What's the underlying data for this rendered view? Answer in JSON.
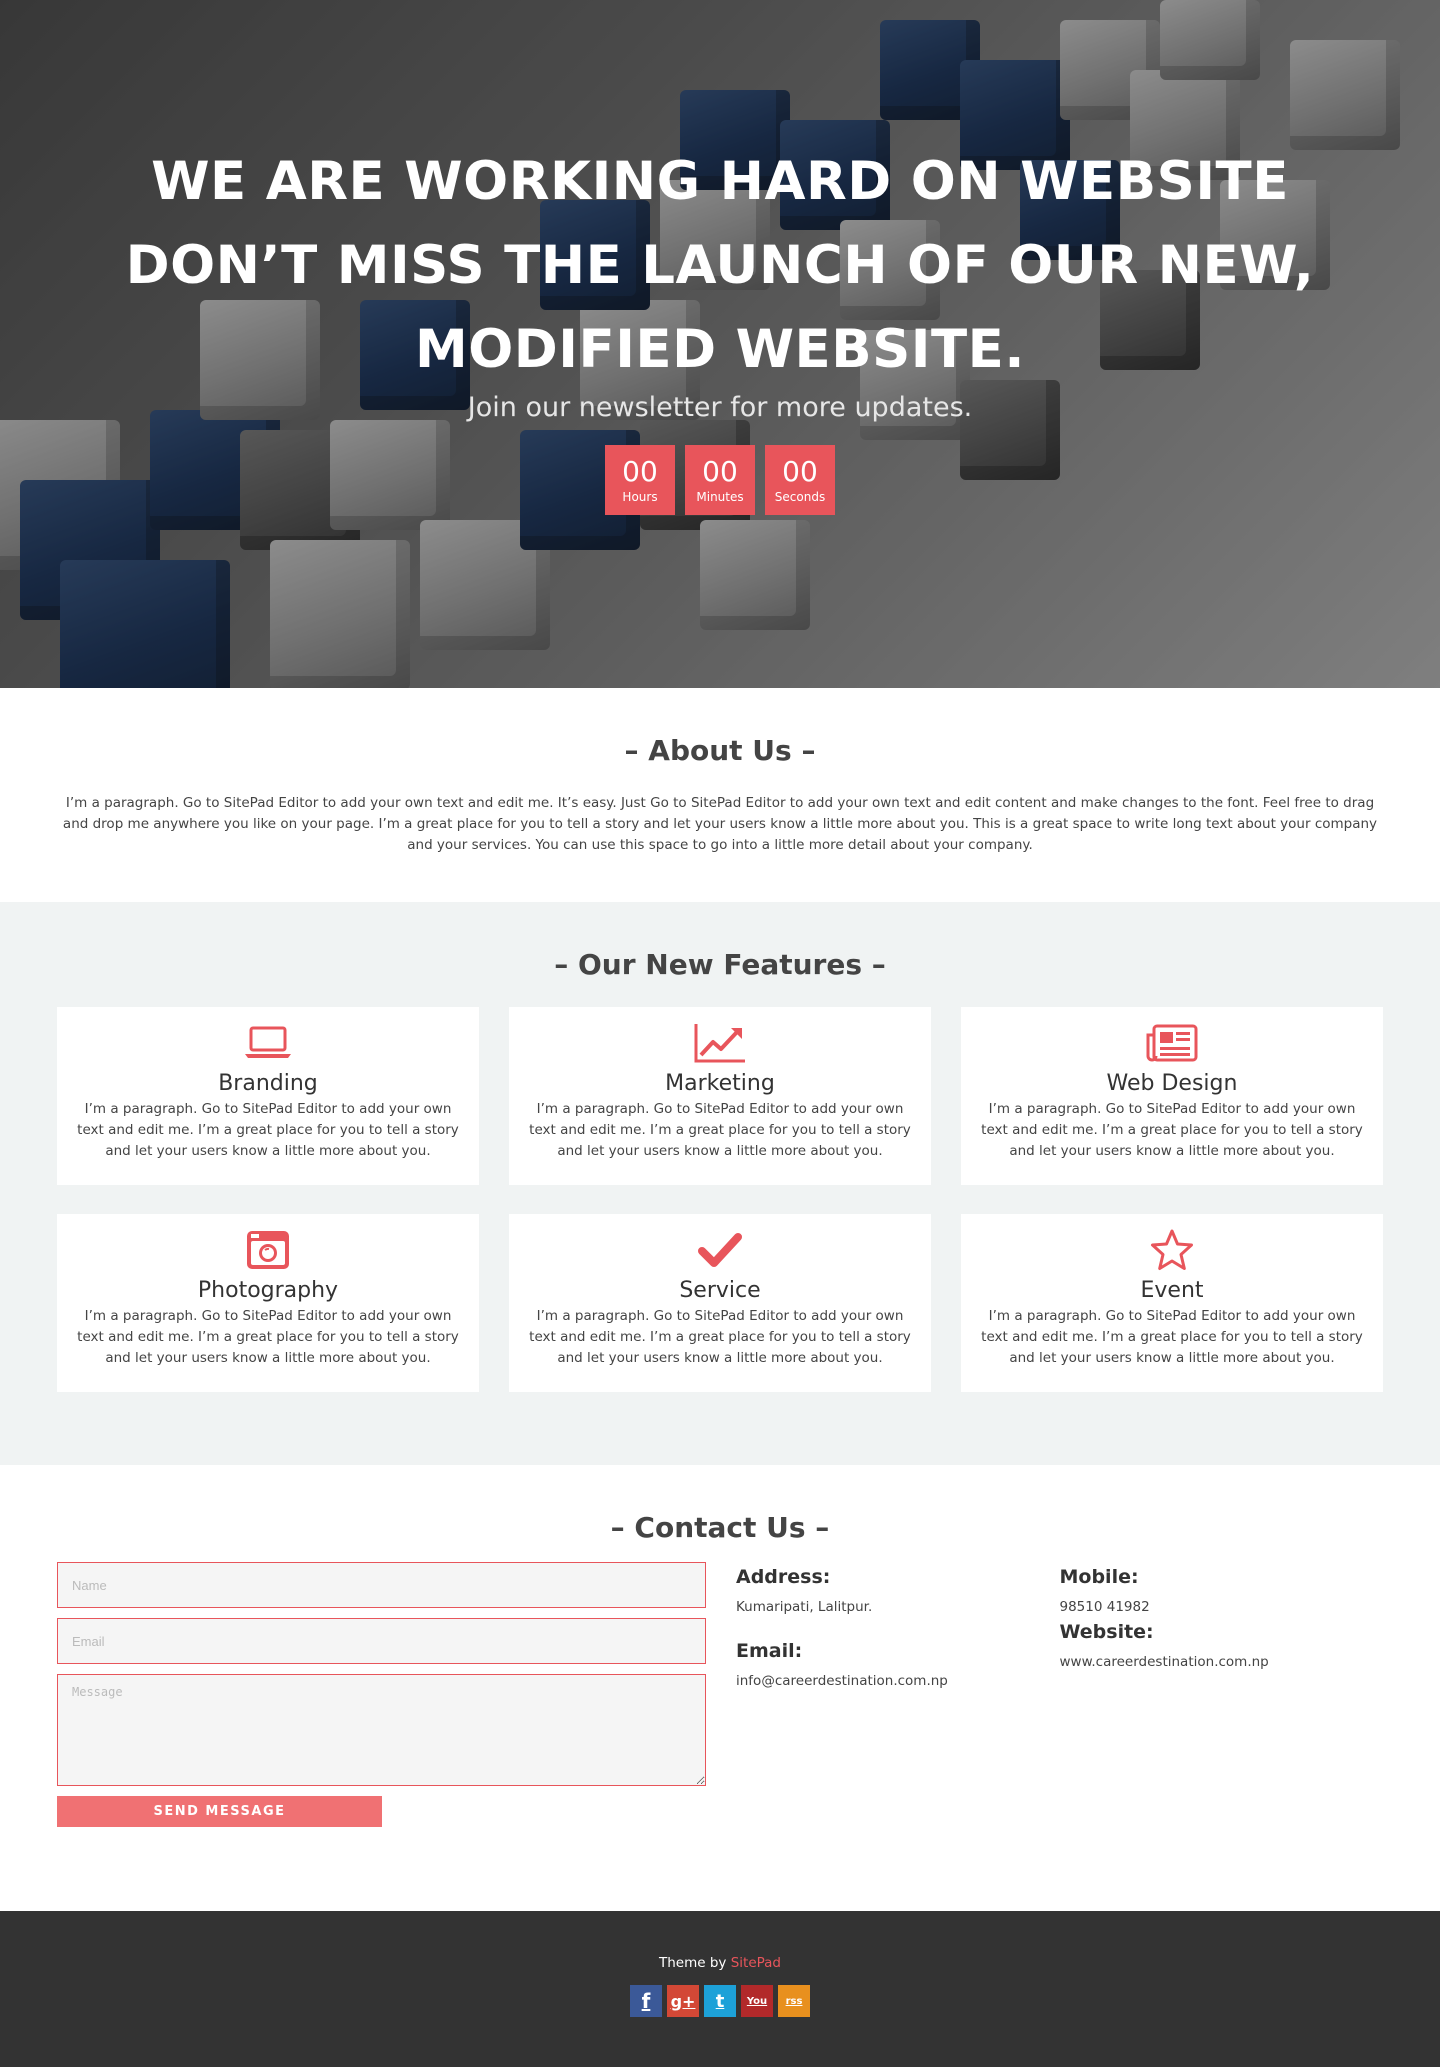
{
  "hero": {
    "title_lines": [
      "WE ARE WORKING HARD ON WEBSITE",
      "DON’T MISS THE LAUNCH OF OUR NEW,",
      "MODIFIED WEBSITE."
    ],
    "subtitle": "Join our newsletter for more updates.",
    "countdown": [
      {
        "value": "00",
        "label": "Hours"
      },
      {
        "value": "00",
        "label": "Minutes"
      },
      {
        "value": "00",
        "label": "Seconds"
      }
    ]
  },
  "about": {
    "title": "– About Us –",
    "text": "I’m a paragraph. Go to SitePad Editor to add your own text and edit me. It’s easy. Just Go to SitePad Editor to add your own text and edit content and make changes to the font. Feel free to drag and drop me anywhere you like on your page. I’m a great place for you to tell a story and let your users know a little more about you. This is a great space to write long text about your company and your services. You can use this space to go into a little more detail about your company."
  },
  "features": {
    "title": "– Our New Features –",
    "items": [
      {
        "name": "Branding",
        "icon": "laptop-icon",
        "text": "I’m a paragraph. Go to SitePad Editor to add your own text and edit me. I’m a great place for you to tell a story and let your users know a little more about you."
      },
      {
        "name": "Marketing",
        "icon": "line-chart-icon",
        "text": "I’m a paragraph. Go to SitePad Editor to add your own text and edit me. I’m a great place for you to tell a story and let your users know a little more about you."
      },
      {
        "name": "Web Design",
        "icon": "newspaper-icon",
        "text": "I’m a paragraph. Go to SitePad Editor to add your own text and edit me. I’m a great place for you to tell a story and let your users know a little more about you."
      },
      {
        "name": "Photography",
        "icon": "camera-icon",
        "text": "I’m a paragraph. Go to SitePad Editor to add your own text and edit me. I’m a great place for you to tell a story and let your users know a little more about you."
      },
      {
        "name": "Service",
        "icon": "check-icon",
        "text": "I’m a paragraph. Go to SitePad Editor to add your own text and edit me. I’m a great place for you to tell a story and let your users know a little more about you."
      },
      {
        "name": "Event",
        "icon": "star-icon",
        "text": "I’m a paragraph. Go to SitePad Editor to add your own text and edit me. I’m a great place for you to tell a story and let your users know a little more about you."
      }
    ]
  },
  "contact": {
    "title": "– Contact Us –",
    "form": {
      "name_placeholder": "Name",
      "email_placeholder": "Email",
      "message_placeholder": "Message",
      "send_label": "SEND MESSAGE"
    },
    "address_label": "Address:",
    "address_value": "Kumaripati, Lalitpur.",
    "email_label": "Email:",
    "email_value": "info@careerdestination.com.np",
    "mobile_label": "Mobile:",
    "mobile_value": "98510 41982",
    "website_label": "Website:",
    "website_value": "www.careerdestination.com.np"
  },
  "footer": {
    "credit_prefix": "Theme by",
    "credit_link": "SitePad",
    "socials": [
      {
        "name": "facebook",
        "glyph": "f",
        "color": "#3b5998"
      },
      {
        "name": "google-plus",
        "glyph": "g+",
        "color": "#d34836"
      },
      {
        "name": "twitter",
        "glyph": "t",
        "color": "#1da1d8"
      },
      {
        "name": "youtube",
        "glyph": "You",
        "color": "#b2292a"
      },
      {
        "name": "rss",
        "glyph": "rss",
        "color": "#e8901e"
      }
    ]
  },
  "colors": {
    "accent": "#e8555b",
    "button": "#f07173",
    "features_bg": "#f0f3f3",
    "footer_bg": "#333333"
  }
}
